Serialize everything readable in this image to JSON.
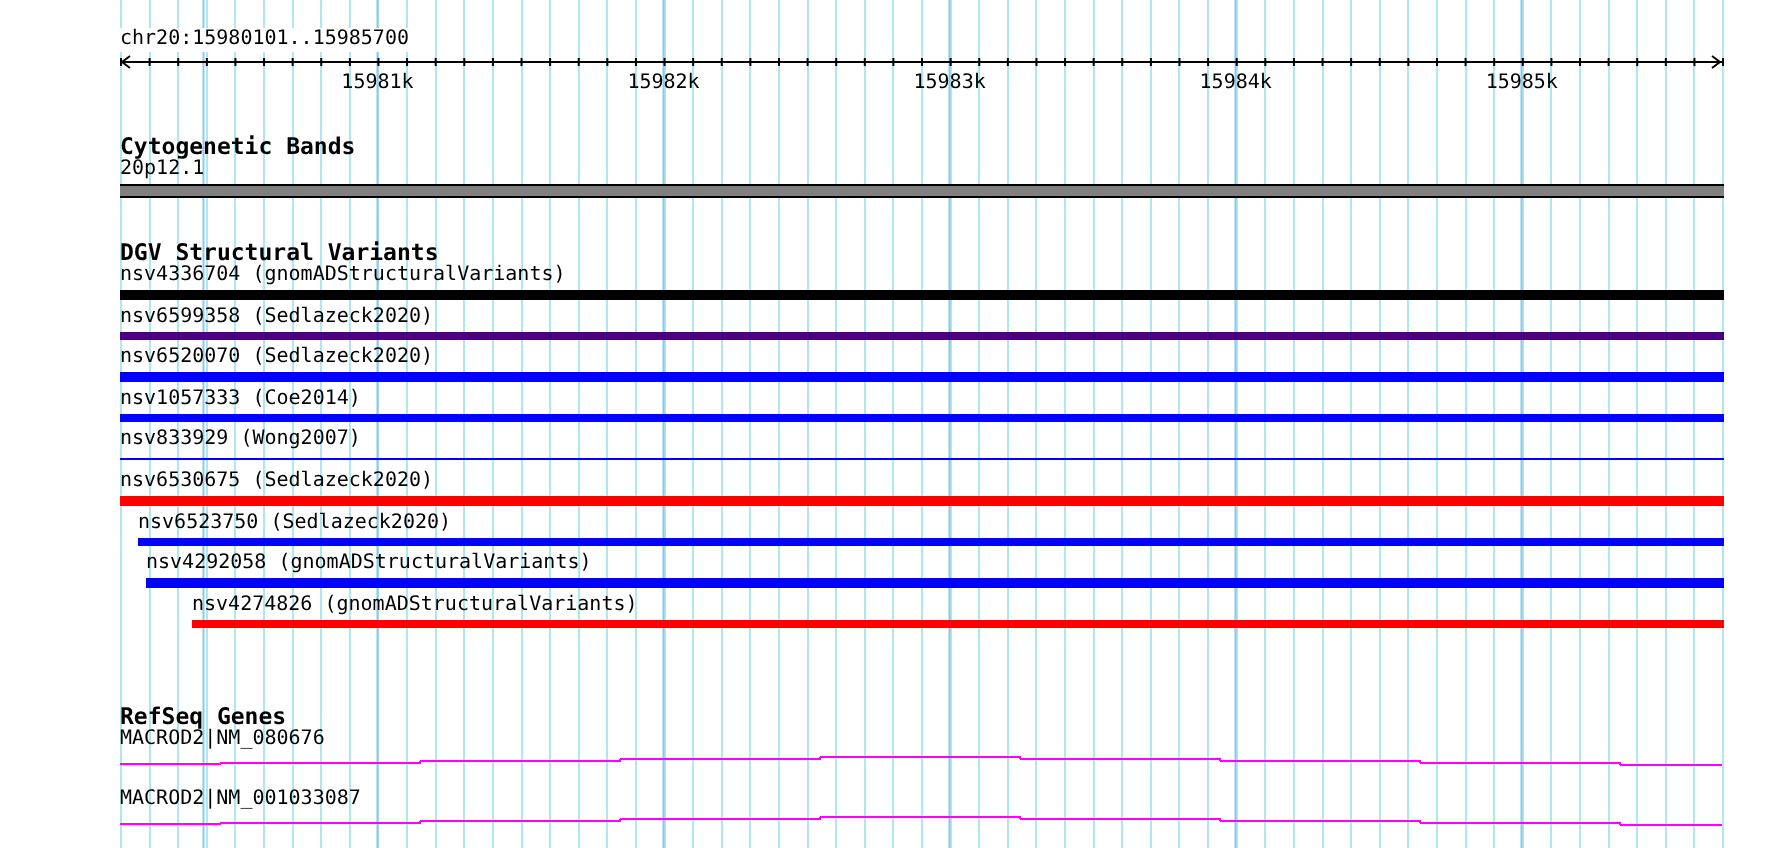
{
  "ruler": {
    "title": "chr20:15980101..15985700",
    "ticks": [
      "15981k",
      "15982k",
      "15983k",
      "15984k",
      "15985k"
    ]
  },
  "cytobands": {
    "title": "Cytogenetic Bands",
    "features": [
      {
        "label": "20p12.1"
      }
    ]
  },
  "variants": {
    "title": "DGV Structural Variants",
    "features": [
      {
        "label": "nsv4336704 (gnomADStructuralVariants)",
        "kind": "bar",
        "color": "#000000"
      },
      {
        "label": "nsv6599358 (Sedlazeck2020)",
        "kind": "bar",
        "color": "#4b0082"
      },
      {
        "label": "nsv6520070 (Sedlazeck2020)",
        "kind": "bar",
        "color": "#0000ff"
      },
      {
        "label": "nsv1057333 (Coe2014)",
        "kind": "bar",
        "color": "#0000ff"
      },
      {
        "label": "nsv833929 (Wong2007)",
        "kind": "line",
        "color": "#0000ff"
      },
      {
        "label": "nsv6530675 (Sedlazeck2020)",
        "kind": "bar",
        "color": "#ff0000"
      },
      {
        "label": "nsv6523750 (Sedlazeck2020)",
        "kind": "bar",
        "color": "#0000ff"
      },
      {
        "label": "nsv4292058 (gnomADStructuralVariants)",
        "kind": "bar",
        "color": "#0000ff"
      },
      {
        "label": "nsv4274826 (gnomADStructuralVariants)",
        "kind": "bar",
        "color": "#ff0000"
      }
    ]
  },
  "genes": {
    "title": "RefSeq Genes",
    "features": [
      {
        "label": "MACROD2|NM_080676"
      },
      {
        "label": "MACROD2|NM_001033087"
      }
    ]
  }
}
